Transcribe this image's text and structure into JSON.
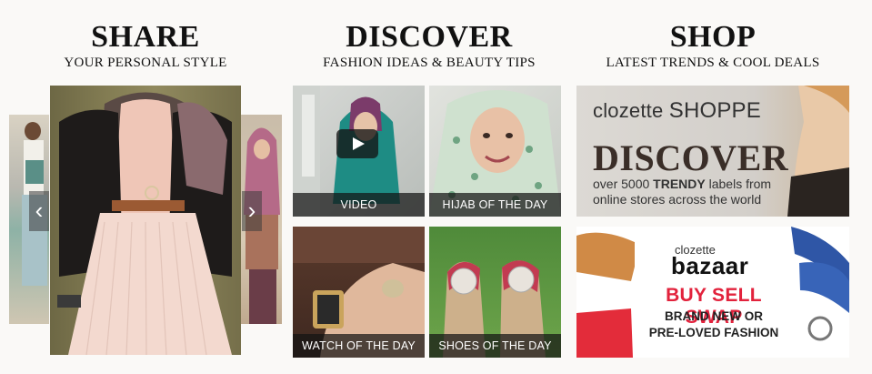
{
  "share": {
    "title": "SHARE",
    "subtitle": "YOUR PERSONAL STYLE"
  },
  "discover": {
    "title": "DISCOVER",
    "subtitle": "FASHION IDEAS & BEAUTY TIPS",
    "tiles": [
      {
        "caption": "VIDEO"
      },
      {
        "caption": "HIJAB OF THE DAY"
      },
      {
        "caption": "WATCH OF THE DAY"
      },
      {
        "caption": "SHOES OF THE DAY"
      }
    ]
  },
  "shop": {
    "title": "SHOP",
    "subtitle": "LATEST TRENDS & COOL DEALS",
    "shoppe": {
      "brand": "clozette",
      "brand_suffix": "SHOPPE",
      "headline": "DISCOVER",
      "line1_pre": "over 5000",
      "line1_bold": "TRENDY",
      "line1_post": "labels from",
      "line2": "online stores across the world"
    },
    "bazaar": {
      "brand_top": "clozette",
      "brand_main": "bazaar",
      "headline": "BUY SELL SWAP",
      "line1": "BRAND NEW OR",
      "line2": "PRE-LOVED FASHION"
    }
  },
  "carousel": {
    "prev_icon": "chevron-left-icon",
    "next_icon": "chevron-right-icon"
  },
  "colors": {
    "accent_red": "#e2223c",
    "caption_bg": "#141414",
    "teal": "#1f8f86"
  }
}
